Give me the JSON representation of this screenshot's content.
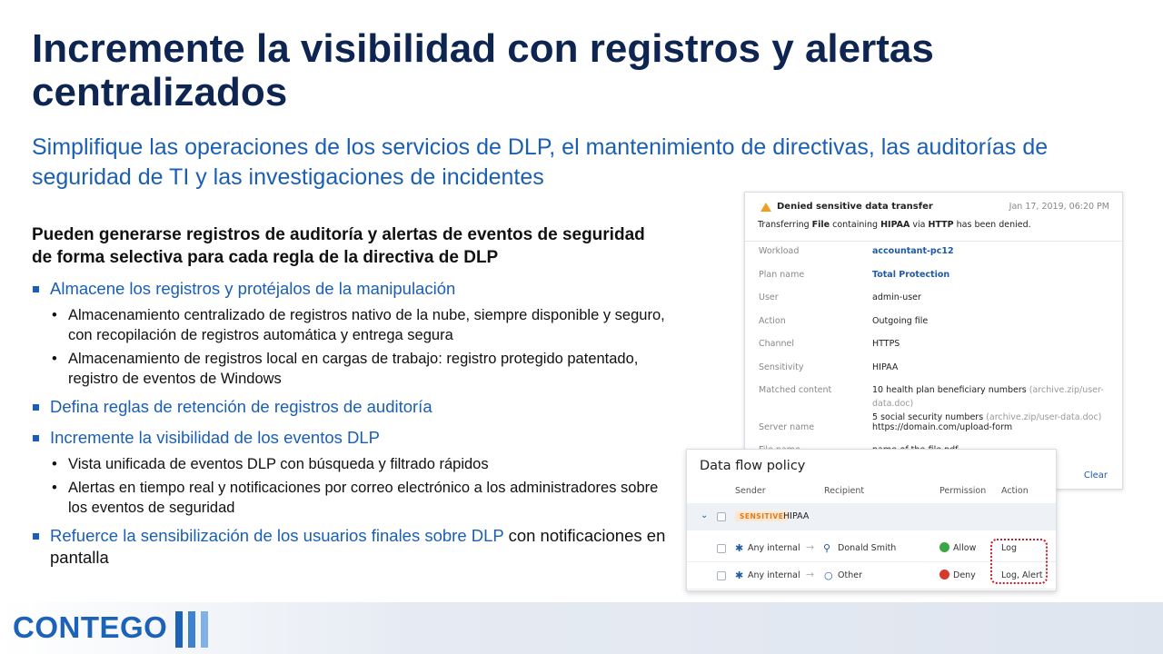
{
  "title": "Incremente la visibilidad con registros y alertas centralizados",
  "subtitle": "Simplifique las operaciones de los servicios de DLP, el mantenimiento de directivas, las auditorías de seguridad de TI y las investigaciones de incidentes",
  "lead": "Pueden generarse registros de auditoría y alertas de eventos de seguridad de forma selectiva para cada regla de la directiva de DLP",
  "bullets": {
    "b1": "Almacene los registros y protéjalos de la manipulación",
    "b1_sub1": "Almacenamiento centralizado de registros nativo de la nube, siempre disponible y seguro, con recopilación de registros automática y entrega segura",
    "b1_sub2": "Almacenamiento de registros local en cargas de trabajo: registro protegido patentado, registro de eventos de Windows",
    "b2": "Defina reglas de retención de registros de auditoría",
    "b3": "Incremente la visibilidad de los eventos DLP",
    "b3_sub1": "Vista unificada de eventos DLP con búsqueda y filtrado rápidos",
    "b3_sub2": "Alertas en tiempo real y notificaciones por correo electrónico a los administradores sobre los eventos de seguridad",
    "b4_blue": "Refuerce la sensibilización de los usuarios finales sobre DLP",
    "b4_plain": " con notificaciones en pantalla"
  },
  "event_card": {
    "title": "Denied sensitive data transfer",
    "date": "Jan 17, 2019, 06:20 PM",
    "msg_1": "Transferring ",
    "msg_file": "File",
    "msg_2": " containing ",
    "msg_hipaa": "HIPAA",
    "msg_3": " via ",
    "msg_http": "HTTP",
    "msg_4": " has been denied.",
    "fields": [
      {
        "label": "Workload",
        "value": "accountant-pc12"
      },
      {
        "label": "Plan name",
        "value": "Total Protection"
      },
      {
        "label": "User",
        "value": "admin-user"
      },
      {
        "label": "Action",
        "value": "Outgoing file"
      },
      {
        "label": "Channel",
        "value": "HTTPS"
      },
      {
        "label": "Sensitivity",
        "value": "HIPAA"
      },
      {
        "label": "Matched content",
        "value": "10 health plan beneficiary numbers",
        "path": "(archive.zip/user-data.doc)",
        "value2": "5 social security numbers",
        "path2": "(archive.zip/user-data.doc)"
      },
      {
        "label": "Server name",
        "value": "https://domain.com/upload-form"
      },
      {
        "label": "File name",
        "value": "name-of-the-file.pdf"
      }
    ],
    "clear": "Clear"
  },
  "policy": {
    "title": "Data flow policy",
    "headers": {
      "sender": "Sender",
      "recipient": "Recipient",
      "permission": "Permission",
      "action": "Action"
    },
    "group_badge": "SENSITIVE",
    "group_name": "HIPAA",
    "rows": [
      {
        "sender": "Any internal",
        "recipient": "Donald Smith",
        "permission": "Allow",
        "action": "Log"
      },
      {
        "sender": "Any internal",
        "recipient": "Other",
        "permission": "Deny",
        "action": "Log, Alert"
      }
    ]
  },
  "logo": "CONTEGO",
  "colors": {
    "title": "#0d2550",
    "accent": "#1a5fb4",
    "link": "#1f5aa8",
    "allow": "#3aa645",
    "deny": "#d6392e",
    "highlight": "#d0192a",
    "badge": "#e07b1a"
  }
}
